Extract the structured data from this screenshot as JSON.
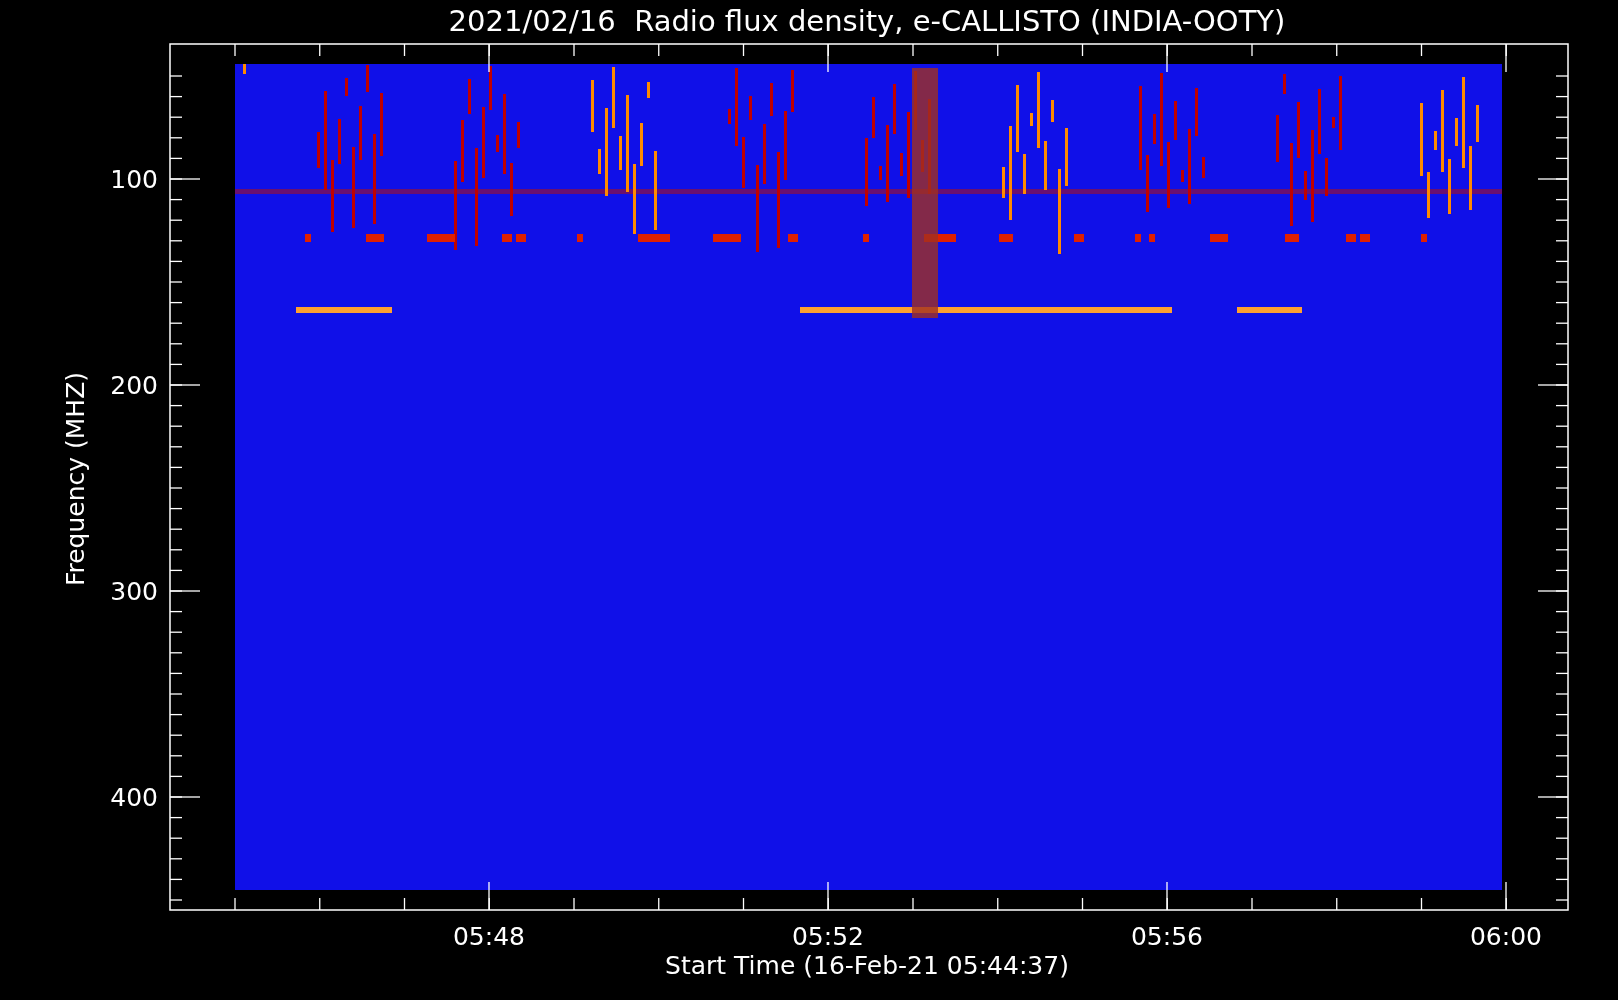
{
  "title": "2021/02/16  Radio flux density, e-CALLISTO (INDIA-OOTY)",
  "plot": {
    "ylabel": "Frequency (MHZ)",
    "xlabel": "Start Time (16-Feb-21 05:44:37)",
    "yticks": [
      "100",
      "200",
      "300",
      "400"
    ],
    "xticks": [
      "05:48",
      "05:52",
      "05:56",
      "06:00"
    ]
  }
}
